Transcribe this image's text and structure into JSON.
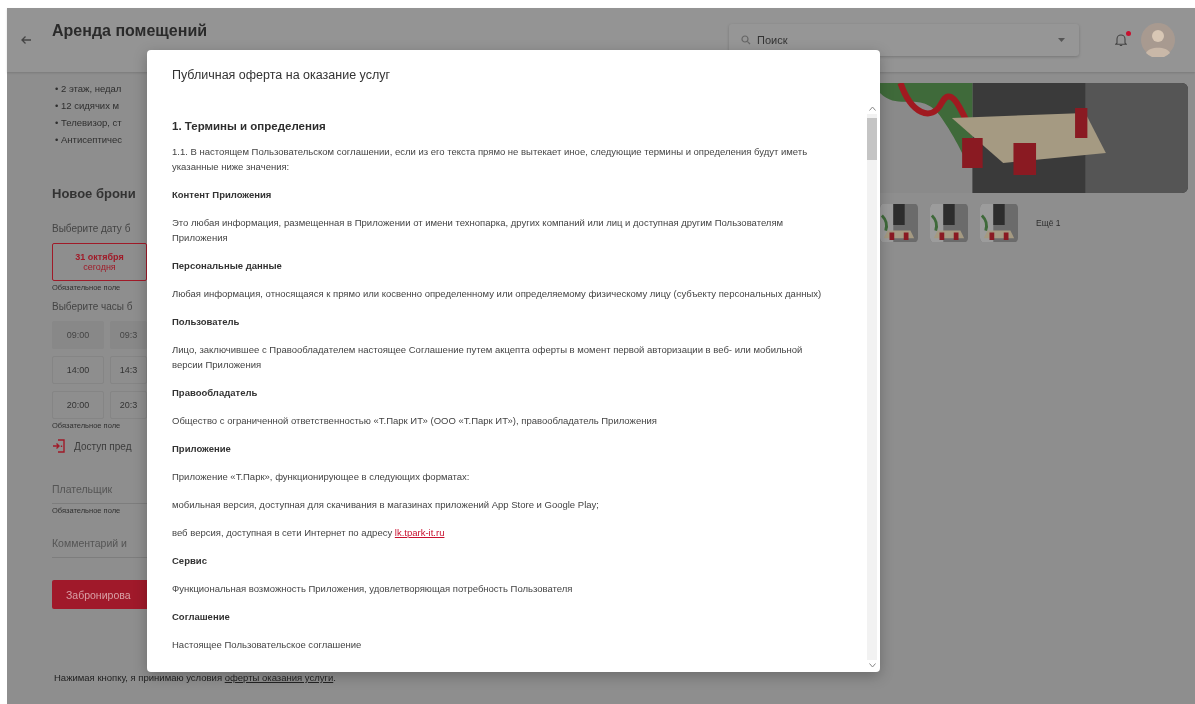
{
  "header": {
    "title": "Аренда помещений",
    "search": {
      "placeholder": "Поиск"
    },
    "notifications": {
      "unread": true
    }
  },
  "room": {
    "features": [
      "• 2 этаж, недал",
      "• 12 сидячих м",
      "• Телевизор, ст",
      "• Антисептичес"
    ],
    "more_photos": "Ещё 1"
  },
  "booking": {
    "title": "Новое брони",
    "date_label": "Выберите дату б",
    "date": {
      "day": "31 октября",
      "note": "сегодня",
      "selected": true
    },
    "date_hint": "Обязательное поле",
    "hours_label": "Выберите часы б",
    "slots": [
      {
        "time": "09:00",
        "disabled": true
      },
      {
        "time": "09:3",
        "disabled": true
      },
      {
        "time": "14:00",
        "disabled": false
      },
      {
        "time": "14:3",
        "disabled": false
      },
      {
        "time": "20:00",
        "disabled": false
      },
      {
        "time": "20:3",
        "disabled": false
      }
    ],
    "hours_hint": "Обязательное поле",
    "access": "Доступ пред",
    "payer": {
      "placeholder": "Плательщик",
      "hint": "Обязательное поле"
    },
    "comment": {
      "placeholder": "Комментарий и"
    },
    "submit": "Забронирова",
    "consent": {
      "text": "Нажимая кнопку, я принимаю условия",
      "link": "оферты оказания услуги",
      "end": "."
    }
  },
  "modal": {
    "title": "Публичная оферта на оказание услуг",
    "blocks": [
      {
        "kind": "heading",
        "text": "1. Термины и определения"
      },
      {
        "kind": "paragraph",
        "text": "1.1. В настоящем Пользовательском соглашении, если из его текста прямо не вытекает иное, следующие термины и определения будут иметь указанные ниже значения:"
      },
      {
        "kind": "term",
        "text": "Контент Приложения"
      },
      {
        "kind": "paragraph",
        "text": "Это любая информация, размещенная в Приложении от имени технопарка, других компаний или лиц и доступная другим Пользователям Приложения"
      },
      {
        "kind": "term",
        "text": "Персональные данные"
      },
      {
        "kind": "paragraph",
        "text": "Любая информация, относящаяся к прямо или косвенно определенному или определяемому физическому лицу (субъекту персональных данных)"
      },
      {
        "kind": "term",
        "text": "Пользователь"
      },
      {
        "kind": "paragraph",
        "text": "Лицо, заключившее с Правообладателем настоящее Соглашение путем акцепта оферты в момент первой авторизации в веб- или мобильной версии Приложения"
      },
      {
        "kind": "term",
        "text": "Правообладатель"
      },
      {
        "kind": "paragraph",
        "text": "Общество с ограниченной ответственностью «Т.Парк ИТ» (ООО «Т.Парк ИТ»), правообладатель Приложения"
      },
      {
        "kind": "term",
        "text": "Приложение"
      },
      {
        "kind": "paragraph",
        "text": "Приложение «Т.Парк», функционирующее в следующих форматах:"
      },
      {
        "kind": "paragraph",
        "text": "мобильная версия, доступная для скачивания в магазинах приложений App Store и Google Play;"
      },
      {
        "kind": "link_paragraph",
        "text": "веб версия, доступная в сети Интернет по адресу",
        "link": "lk.tpark-it.ru"
      },
      {
        "kind": "term",
        "text": "Сервис"
      },
      {
        "kind": "paragraph",
        "text": "Функциональная возможность Приложения, удовлетворяющая потребность Пользователя"
      },
      {
        "kind": "term",
        "text": "Соглашение"
      },
      {
        "kind": "paragraph",
        "text": "Настоящее Пользовательское соглашение"
      }
    ]
  }
}
